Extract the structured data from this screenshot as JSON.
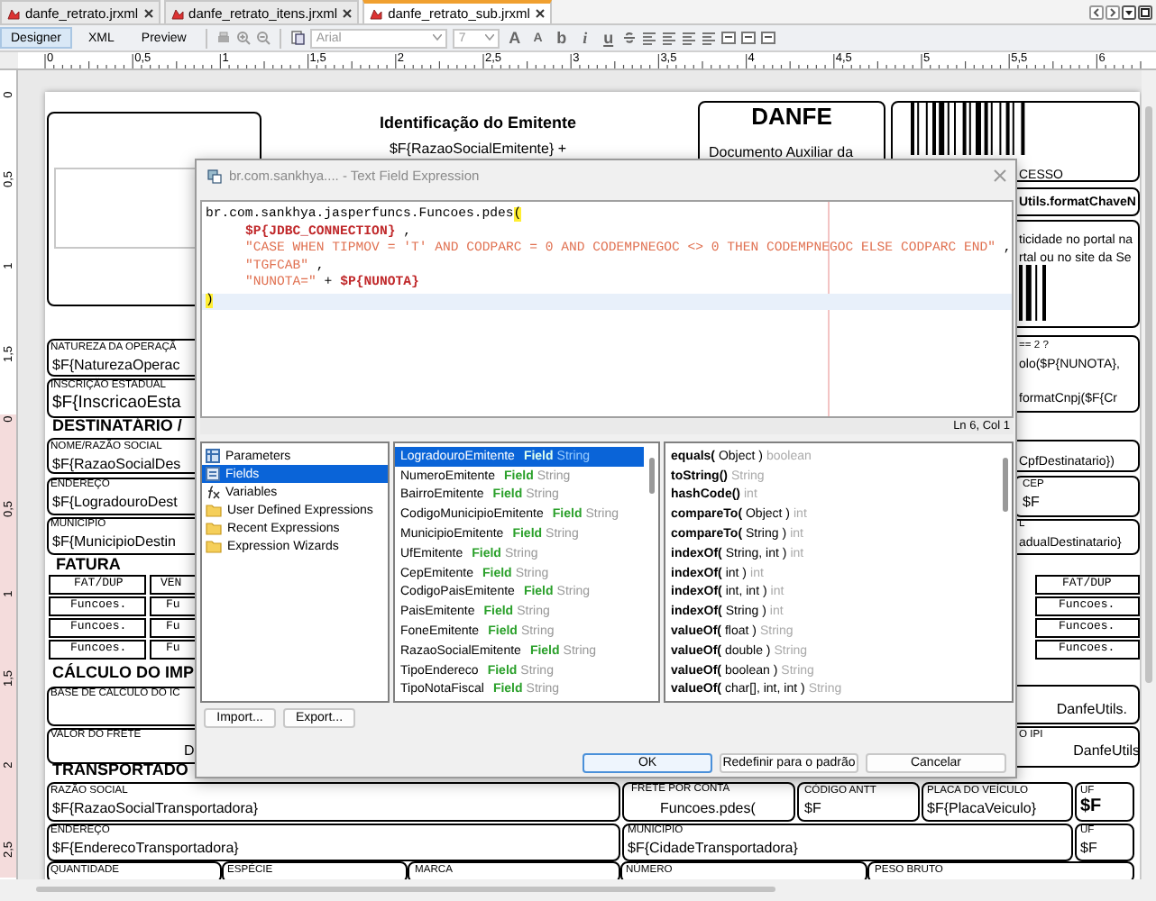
{
  "tabs": [
    {
      "label": "danfe_retrato.jrxml",
      "selected": false
    },
    {
      "label": "danfe_retrato_itens.jrxml",
      "selected": false
    },
    {
      "label": "danfe_retrato_sub.jrxml",
      "selected": true
    }
  ],
  "views": [
    {
      "label": "Designer",
      "selected": true
    },
    {
      "label": "XML",
      "selected": false
    },
    {
      "label": "Preview",
      "selected": false
    }
  ],
  "toolbar": {
    "font": {
      "value": "Arial",
      "disabled": true
    },
    "size": {
      "value": "7",
      "disabled": true
    },
    "format_buttons": [
      {
        "kind": "grow",
        "text": "A"
      },
      {
        "kind": "shrink",
        "text": "A"
      },
      {
        "kind": "bold",
        "text": "b"
      },
      {
        "kind": "italic",
        "text": "i"
      },
      {
        "kind": "underline",
        "text": "u"
      }
    ]
  },
  "ruler": {
    "horizontal": [
      "0",
      "0,5",
      "1",
      "1,5",
      "2",
      "2,5",
      "3",
      "3,5",
      "4",
      "4,5",
      "5",
      "5,5",
      "6"
    ],
    "vertical": [
      {
        "label": "0",
        "highlighted": false
      },
      {
        "label": "0,5",
        "highlighted": false
      },
      {
        "label": "1",
        "highlighted": false
      },
      {
        "label": "1,5",
        "highlighted": false
      },
      {
        "label": "0",
        "highlighted": true
      },
      {
        "label": "0,5",
        "highlighted": true
      },
      {
        "label": "1",
        "highlighted": true
      },
      {
        "label": "1,5",
        "highlighted": true
      },
      {
        "label": "2",
        "highlighted": true
      },
      {
        "label": "2,5",
        "highlighted": true
      }
    ]
  },
  "report": {
    "texts": [
      {
        "kind": "heading",
        "text": "Identificação do Emitente"
      },
      {
        "kind": "value",
        "text": "$F{RazaoSocialEmitente} +"
      },
      {
        "kind": "danfe",
        "text": "DANFE"
      },
      {
        "kind": "value",
        "text": "Documento Auxiliar da"
      },
      {
        "kind": "edge",
        "text": "CESSO"
      },
      {
        "kind": "edge_bold",
        "text": "Utils.formatChaveN"
      },
      {
        "kind": "edge",
        "text": "ticidade no portal na"
      },
      {
        "kind": "edge",
        "text": "rtal ou no site da Se"
      },
      {
        "kind": "label",
        "text": "== 2 ?"
      },
      {
        "kind": "edge",
        "text": "olo($P{NUNOTA},"
      },
      {
        "kind": "edge",
        "text": "formatCnpj($F{Cr"
      },
      {
        "kind": "edge",
        "text": "CpfDestinatario})"
      },
      {
        "kind": "label",
        "text": "CEP"
      },
      {
        "kind": "value",
        "text": "$F"
      },
      {
        "kind": "label",
        "text": "L"
      },
      {
        "kind": "edge",
        "text": "adualDestinatario}"
      },
      {
        "kind": "mono",
        "text": "FAT/DUP"
      },
      {
        "kind": "mono",
        "text": "Funcoes."
      },
      {
        "kind": "mono",
        "text": "Funcoes."
      },
      {
        "kind": "mono",
        "text": "Funcoes."
      },
      {
        "kind": "value",
        "text": "DanfeUtils."
      },
      {
        "kind": "label",
        "text": "O IPI"
      },
      {
        "kind": "value",
        "text": "DanfeUtils"
      },
      {
        "kind": "label",
        "text": "NATUREZA DA OPERAÇÃ"
      },
      {
        "kind": "value",
        "text": "$F{NaturezaOperac"
      },
      {
        "kind": "label",
        "text": "INSCRIÇÃO ESTADUAL"
      },
      {
        "kind": "large",
        "text": "$F{InscricaoEsta"
      },
      {
        "kind": "heading",
        "text": "DESTINATÁRIO /"
      },
      {
        "kind": "label",
        "text": "NOME/RAZÃO SOCIAL"
      },
      {
        "kind": "value",
        "text": "$F{RazaoSocialDes"
      },
      {
        "kind": "label",
        "text": "ENDEREÇO"
      },
      {
        "kind": "value",
        "text": "$F{LogradouroDest"
      },
      {
        "kind": "label",
        "text": "MUNICÍPIO"
      },
      {
        "kind": "value",
        "text": "$F{MunicipioDestin"
      },
      {
        "kind": "heading",
        "text": "FATURA"
      },
      {
        "kind": "mono",
        "text": "FAT/DUP"
      },
      {
        "kind": "mono",
        "text": "VEN"
      },
      {
        "kind": "mono",
        "text": "Funcoes."
      },
      {
        "kind": "mono",
        "text": "Funcoes."
      },
      {
        "kind": "mono",
        "text": "Funcoes."
      },
      {
        "kind": "mono",
        "text": "Fu"
      },
      {
        "kind": "mono",
        "text": "Fu"
      },
      {
        "kind": "mono",
        "text": "Fu"
      },
      {
        "kind": "heading",
        "text": "CÁLCULO DO IMP"
      },
      {
        "kind": "label",
        "text": "BASE DE CÁLCULO DO IC"
      },
      {
        "kind": "label",
        "text": "VALOR DO FRETE"
      },
      {
        "kind": "value",
        "text": "D"
      },
      {
        "kind": "heading",
        "text": "TRANSPORTADO"
      },
      {
        "kind": "label",
        "text": "RAZÃO SOCIAL"
      },
      {
        "kind": "value",
        "text": "$F{RazaoSocialTransportadora}"
      },
      {
        "kind": "label",
        "text": "FRETE POR CONTA"
      },
      {
        "kind": "value",
        "text": "Funcoes.pdes("
      },
      {
        "kind": "label",
        "text": "CÓDIGO ANTT"
      },
      {
        "kind": "value",
        "text": "$F"
      },
      {
        "kind": "label",
        "text": "PLACA DO VEÍCULO"
      },
      {
        "kind": "value",
        "text": "$F{PlacaVeiculo}"
      },
      {
        "kind": "label",
        "text": "UF"
      },
      {
        "kind": "large_bold",
        "text": "$F"
      },
      {
        "kind": "label",
        "text": "ENDEREÇO"
      },
      {
        "kind": "value",
        "text": "$F{EnderecoTransportadora}"
      },
      {
        "kind": "label",
        "text": "MUNICÍPIO"
      },
      {
        "kind": "value",
        "text": "$F{CidadeTransportadora}"
      },
      {
        "kind": "label",
        "text": "UF"
      },
      {
        "kind": "value",
        "text": "$F"
      },
      {
        "kind": "label",
        "text": "QUANTIDADE"
      },
      {
        "kind": "label",
        "text": "ESPÉCIE"
      },
      {
        "kind": "label",
        "text": "MARCA"
      },
      {
        "kind": "label",
        "text": "NÚMERO"
      },
      {
        "kind": "label",
        "text": "PESO BRUTO"
      }
    ]
  },
  "dialog": {
    "title": "br.com.sankhya.... - Text Field Expression",
    "editor": {
      "lines": [
        {
          "current": false,
          "segments": [
            {
              "kind": "plain",
              "text": "br.com.sankhya.jasperfuncs.Funcoes.pdes"
            },
            {
              "kind": "match",
              "text": "("
            }
          ]
        },
        {
          "current": false,
          "indented": true,
          "segments": [
            {
              "kind": "param",
              "text": "$P{JDBC_CONNECTION}"
            },
            {
              "kind": "plain",
              "text": " ,"
            }
          ]
        },
        {
          "current": false,
          "indented": true,
          "segments": [
            {
              "kind": "string",
              "text": "\"CASE WHEN TIPMOV = 'T' AND CODPARC = 0 AND CODEMPNEGOC <> 0 THEN CODEMPNEGOC ELSE CODPARC END\""
            },
            {
              "kind": "plain",
              "text": " ,"
            }
          ]
        },
        {
          "current": false,
          "indented": true,
          "segments": [
            {
              "kind": "string",
              "text": "\"TGFCAB\""
            },
            {
              "kind": "plain",
              "text": " ,"
            }
          ]
        },
        {
          "current": false,
          "indented": true,
          "segments": [
            {
              "kind": "string",
              "text": "\"NUNOTA=\""
            },
            {
              "kind": "plain",
              "text": " + "
            },
            {
              "kind": "param",
              "text": "$P{NUNOTA}"
            }
          ]
        },
        {
          "current": true,
          "segments": [
            {
              "kind": "match",
              "text": ")"
            }
          ]
        }
      ],
      "status": "Ln 6, Col 1"
    },
    "categories": [
      {
        "kind": "parameters",
        "label": "Parameters",
        "selected": false
      },
      {
        "kind": "fields",
        "label": "Fields",
        "selected": true
      },
      {
        "kind": "variables",
        "label": "Variables",
        "selected": false
      },
      {
        "kind": "folder",
        "label": "User Defined Expressions",
        "selected": false
      },
      {
        "kind": "folder",
        "label": "Recent Expressions",
        "selected": false
      },
      {
        "kind": "folder",
        "label": "Expression Wizards",
        "selected": false
      }
    ],
    "fields": [
      {
        "name": "LogradouroEmitente",
        "type": "Field",
        "class": "String",
        "selected": true
      },
      {
        "name": "NumeroEmitente",
        "type": "Field",
        "class": "String",
        "selected": false
      },
      {
        "name": "BairroEmitente",
        "type": "Field",
        "class": "String",
        "selected": false
      },
      {
        "name": "CodigoMunicipioEmitente",
        "type": "Field",
        "class": "String",
        "selected": false
      },
      {
        "name": "MunicipioEmitente",
        "type": "Field",
        "class": "String",
        "selected": false
      },
      {
        "name": "UfEmitente",
        "type": "Field",
        "class": "String",
        "selected": false
      },
      {
        "name": "CepEmitente",
        "type": "Field",
        "class": "String",
        "selected": false
      },
      {
        "name": "CodigoPaisEmitente",
        "type": "Field",
        "class": "String",
        "selected": false
      },
      {
        "name": "PaisEmitente",
        "type": "Field",
        "class": "String",
        "selected": false
      },
      {
        "name": "FoneEmitente",
        "type": "Field",
        "class": "String",
        "selected": false
      },
      {
        "name": "RazaoSocialEmitente",
        "type": "Field",
        "class": "String",
        "selected": false
      },
      {
        "name": "TipoEndereco",
        "type": "Field",
        "class": "String",
        "selected": false
      },
      {
        "name": "TipoNotaFiscal",
        "type": "Field",
        "class": "String",
        "selected": false
      }
    ],
    "methods": [
      {
        "name": "equals(",
        "params": " Object )",
        "returns": "boolean"
      },
      {
        "name": "toString()",
        "returns": "String"
      },
      {
        "name": "hashCode()",
        "returns": "int"
      },
      {
        "name": "compareTo(",
        "params": " Object )",
        "returns": "int"
      },
      {
        "name": "compareTo(",
        "params": " String )",
        "returns": "int"
      },
      {
        "name": "indexOf(",
        "params": " String, int )",
        "returns": "int"
      },
      {
        "name": "indexOf(",
        "params": " int )",
        "returns": "int"
      },
      {
        "name": "indexOf(",
        "params": " int, int )",
        "returns": "int"
      },
      {
        "name": "indexOf(",
        "params": " String )",
        "returns": "int"
      },
      {
        "name": "valueOf(",
        "params": " float )",
        "returns": "String"
      },
      {
        "name": "valueOf(",
        "params": " double )",
        "returns": "String"
      },
      {
        "name": "valueOf(",
        "params": " boolean )",
        "returns": "String"
      },
      {
        "name": "valueOf(",
        "params": " char[], int, int )",
        "returns": "String"
      }
    ],
    "tool_buttons": [
      "Import...",
      "Export..."
    ],
    "buttons": [
      {
        "label": "OK",
        "default": true
      },
      {
        "label": "Redefinir para o padrão",
        "default": false
      },
      {
        "label": "Cancelar",
        "default": false
      }
    ]
  }
}
